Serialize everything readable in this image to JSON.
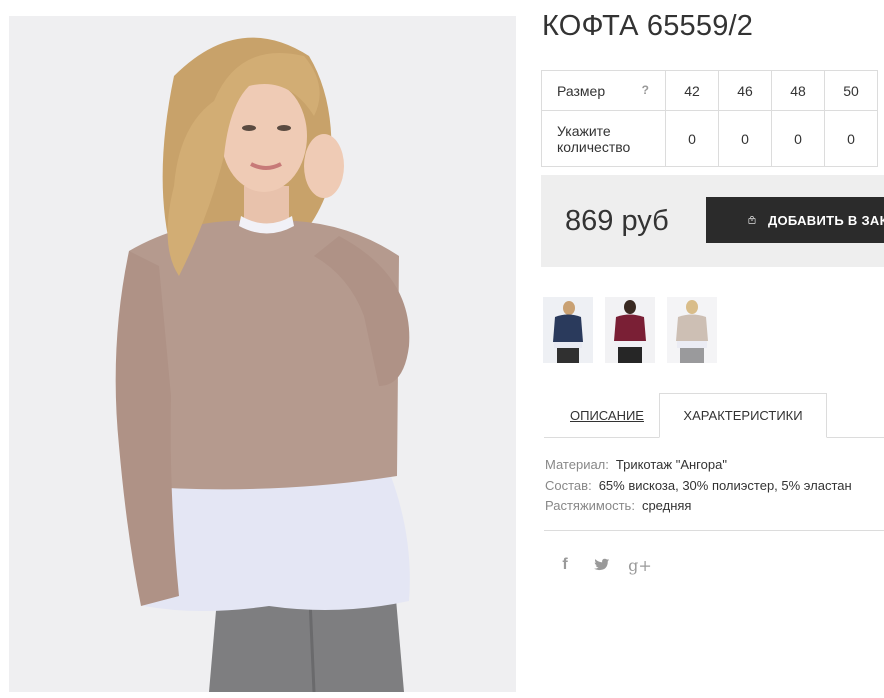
{
  "product": {
    "title": "КОФТА 65559/2",
    "main_image": "photo of model in beige angora sweater with white chiffon hem"
  },
  "sizes": {
    "size_label": "Размер",
    "help_label": "?",
    "qty_label": "Укажите количество",
    "items": [
      {
        "size": "42",
        "qty": "0"
      },
      {
        "size": "46",
        "qty": "0"
      },
      {
        "size": "48",
        "qty": "0"
      },
      {
        "size": "50",
        "qty": "0"
      }
    ]
  },
  "purchase": {
    "price": "869 руб",
    "cart_button": "ДОБАВИТЬ В ЗАКАЗ",
    "cart_icon": "shopping-bag-icon"
  },
  "thumbnails": [
    {
      "color": "#2a3a5c"
    },
    {
      "color": "#7a1f35"
    },
    {
      "color": "#cdbfb4"
    }
  ],
  "tabs": {
    "description": "ОПИСАНИЕ",
    "characteristics": "ХАРАКТЕРИСТИКИ",
    "active": "characteristics"
  },
  "specs": [
    {
      "key": "Материал:",
      "value": "Трикотаж \"Ангора\""
    },
    {
      "key": "Состав:",
      "value": "65% вискоза, 30% полиэстер, 5% эластан"
    },
    {
      "key": "Растяжимость:",
      "value": "средняя"
    }
  ],
  "social": {
    "facebook": "f",
    "twitter": "twitter-bird-icon",
    "google": "g+"
  }
}
